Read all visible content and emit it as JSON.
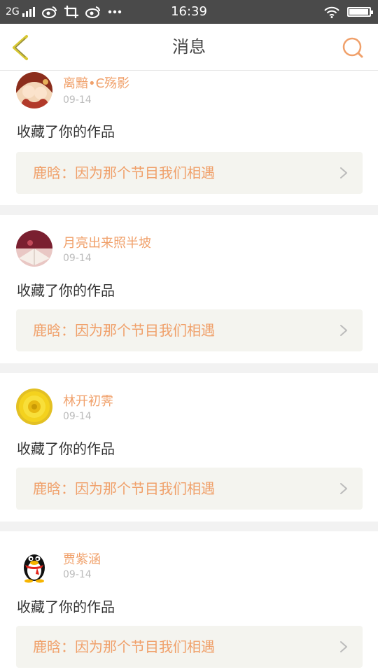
{
  "status_bar": {
    "network": "2G",
    "time": "16:39",
    "battery_level": 0.95
  },
  "header": {
    "title": "消息",
    "back_icon": "chevron-left-icon",
    "search_icon": "search-icon"
  },
  "notifications": [
    {
      "user": "离黯•Є殇影",
      "date": "09-14",
      "action": "收藏了你的作品",
      "work": "鹿晗：因为那个节目我们相遇"
    },
    {
      "user": "月亮出来照半坡",
      "date": "09-14",
      "action": "收藏了你的作品",
      "work": "鹿晗：因为那个节目我们相遇"
    },
    {
      "user": "林开初霁",
      "date": "09-14",
      "action": "收藏了你的作品",
      "work": "鹿晗：因为那个节目我们相遇"
    },
    {
      "user": "贾紫涵",
      "date": "09-14",
      "action": "收藏了你的作品",
      "work": "鹿晗：因为那个节目我们相遇"
    }
  ],
  "colors": {
    "accent": "#f0a06a",
    "status_bar_bg": "#4a4a4a",
    "work_box_bg": "#f4f4ef",
    "back_icon": "#d8c832"
  }
}
